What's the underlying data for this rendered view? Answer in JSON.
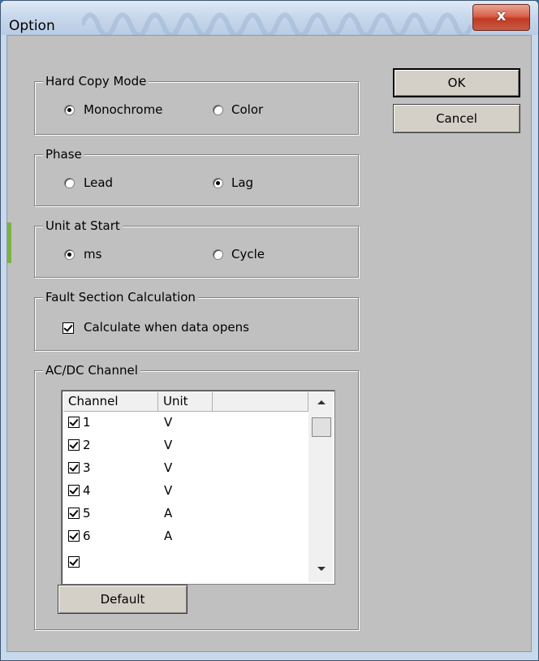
{
  "window": {
    "title": "Option",
    "close_label": "x"
  },
  "buttons": {
    "ok": "OK",
    "cancel": "Cancel",
    "default": "Default"
  },
  "hard_copy_mode": {
    "label": "Hard Copy Mode",
    "options": [
      "Monochrome",
      "Color"
    ],
    "selected": "Monochrome"
  },
  "phase": {
    "label": "Phase",
    "options": [
      "Lead",
      "Lag"
    ],
    "selected": "Lag"
  },
  "unit_at_start": {
    "label": "Unit at Start",
    "options": [
      "ms",
      "Cycle"
    ],
    "selected": "ms"
  },
  "fault_section": {
    "label": "Fault Section Calculation",
    "checkbox_label": "Calculate when data opens",
    "checked": true
  },
  "channels": {
    "label": "AC/DC Channel",
    "columns": [
      "Channel",
      "Unit"
    ],
    "rows": [
      {
        "channel": "1",
        "unit": "V",
        "checked": true
      },
      {
        "channel": "2",
        "unit": "V",
        "checked": true
      },
      {
        "channel": "3",
        "unit": "V",
        "checked": true
      },
      {
        "channel": "4",
        "unit": "V",
        "checked": true
      },
      {
        "channel": "5",
        "unit": "A",
        "checked": true
      },
      {
        "channel": "6",
        "unit": "A",
        "checked": true
      }
    ]
  },
  "colors": {
    "window_bg": "#c0c0c0",
    "close_button": "#c13a22"
  }
}
